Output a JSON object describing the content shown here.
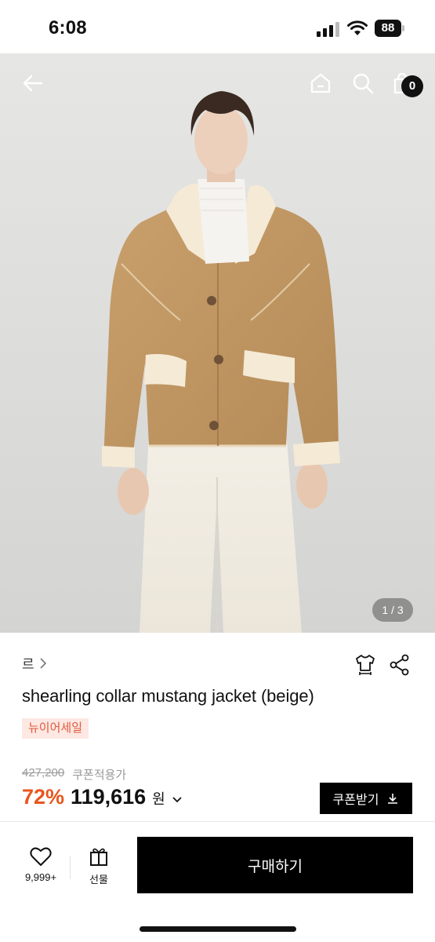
{
  "status_bar": {
    "time": "6:08",
    "battery": "88"
  },
  "hero": {
    "icons": [
      "back-arrow-icon",
      "home-icon",
      "search-icon",
      "shopping-bag-icon"
    ],
    "cart_count": "0",
    "page_indicator": "1 / 3"
  },
  "product": {
    "brand": "르",
    "title": "shearling collar mustang jacket (beige)",
    "tag": "뉴이어세일",
    "original_price": "427,200",
    "coupon_price_label": "쿠폰적용가",
    "discount": "72%",
    "price": "119,616",
    "currency": "원",
    "coupon_button": "쿠폰받기"
  },
  "bottom_bar": {
    "like_count": "9,999+",
    "gift_label": "선물",
    "buy_label": "구매하기"
  },
  "colors": {
    "discount": "#e8561f",
    "tag_bg": "#fde8e3",
    "tag_text": "#e05a3a",
    "primary_button": "#000000"
  }
}
